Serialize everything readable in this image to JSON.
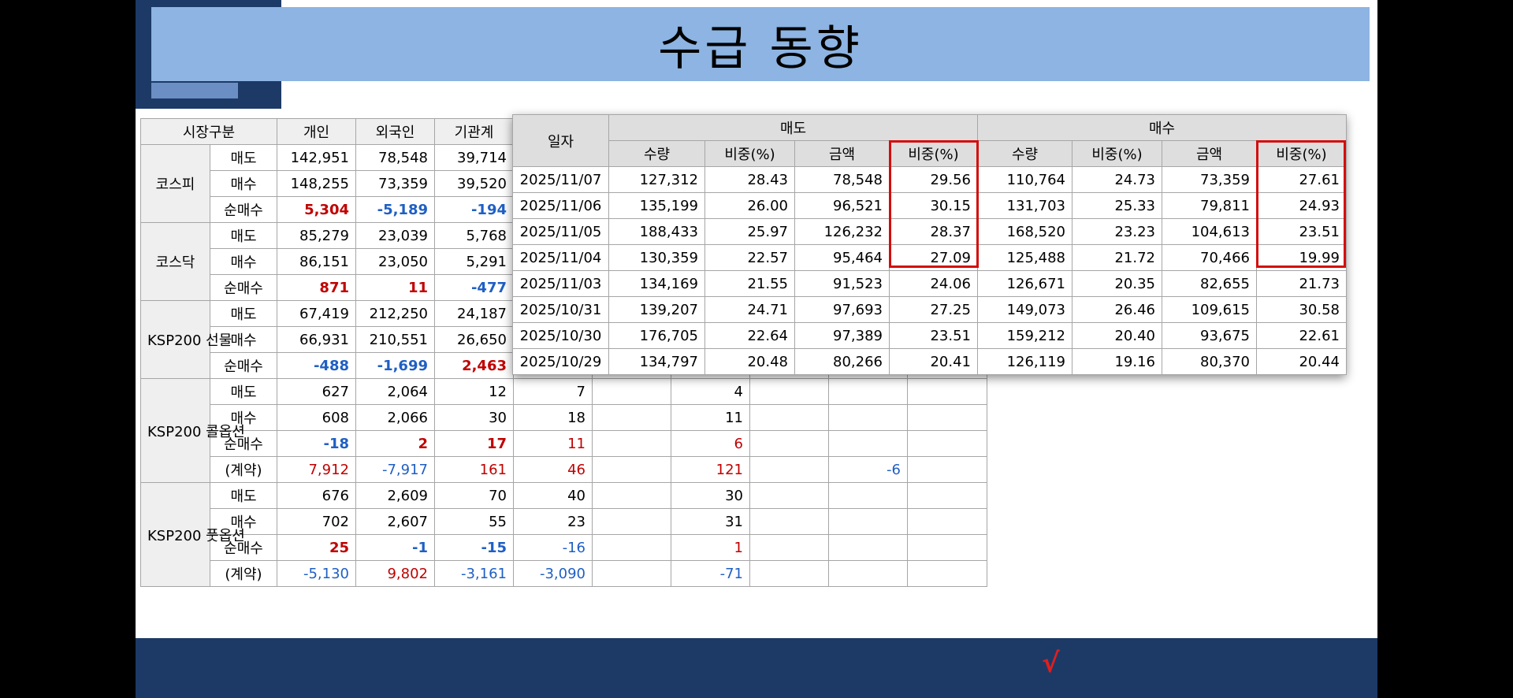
{
  "title": "수급 동향",
  "colors": {
    "accent_navy": "#1d3a66",
    "title_band": "#8db4e2",
    "positive": "#c00000",
    "negative": "#1f5fc4",
    "highlight_box": "#d40d0d"
  },
  "footer": {
    "mark": "√"
  },
  "supply": {
    "headers": [
      "시장구분",
      "개인",
      "외국인",
      "기관계"
    ],
    "markets": [
      {
        "name": "코스피",
        "rows": [
          {
            "label": "매도",
            "values": [
              "142,951",
              "78,548",
              "39,714"
            ]
          },
          {
            "label": "매수",
            "values": [
              "148,255",
              "73,359",
              "39,520"
            ]
          },
          {
            "label": "순매수",
            "values": [
              "5,304",
              "-5,189",
              "-194"
            ]
          }
        ]
      },
      {
        "name": "코스닥",
        "rows": [
          {
            "label": "매도",
            "values": [
              "85,279",
              "23,039",
              "5,768"
            ]
          },
          {
            "label": "매수",
            "values": [
              "86,151",
              "23,050",
              "5,291"
            ]
          },
          {
            "label": "순매수",
            "values": [
              "871",
              "11",
              "-477"
            ]
          }
        ]
      },
      {
        "name": "KSP200 선물",
        "rows": [
          {
            "label": "매도",
            "values": [
              "67,419",
              "212,250",
              "24,187"
            ]
          },
          {
            "label": "매수",
            "values": [
              "66,931",
              "210,551",
              "26,650"
            ]
          },
          {
            "label": "순매수",
            "values": [
              "-488",
              "-1,699",
              "2,463"
            ]
          }
        ]
      },
      {
        "name": "KSP200 콜옵션",
        "rows": [
          {
            "label": "매도",
            "values": [
              "627",
              "2,064",
              "12",
              "7",
              "",
              "4",
              "",
              "",
              ""
            ]
          },
          {
            "label": "매수",
            "values": [
              "608",
              "2,066",
              "30",
              "18",
              "",
              "11",
              "",
              "",
              ""
            ]
          },
          {
            "label": "순매수",
            "values": [
              "-18",
              "2",
              "17",
              "11",
              "",
              "6",
              "",
              "",
              ""
            ]
          },
          {
            "label": "(계약)",
            "values": [
              "7,912",
              "-7,917",
              "161",
              "46",
              "",
              "121",
              "",
              "-6",
              ""
            ]
          }
        ]
      },
      {
        "name": "KSP200 풋옵션",
        "rows": [
          {
            "label": "매도",
            "values": [
              "676",
              "2,609",
              "70",
              "40",
              "",
              "30",
              "",
              "",
              ""
            ]
          },
          {
            "label": "매수",
            "values": [
              "702",
              "2,607",
              "55",
              "23",
              "",
              "31",
              "",
              "",
              ""
            ]
          },
          {
            "label": "순매수",
            "values": [
              "25",
              "-1",
              "-15",
              "-16",
              "",
              "1",
              "",
              "",
              ""
            ]
          },
          {
            "label": "(계약)",
            "values": [
              "-5,130",
              "9,802",
              "-3,161",
              "-3,090",
              "",
              "-71",
              "",
              "",
              ""
            ]
          }
        ]
      }
    ]
  },
  "daily": {
    "date_header": "일자",
    "sell_header": "매도",
    "buy_header": "매수",
    "sub_headers": [
      "수량",
      "비중(%)",
      "금액",
      "비중(%)",
      "수량",
      "비중(%)",
      "금액",
      "비중(%)"
    ],
    "rows": [
      {
        "date": "2025/11/07",
        "cells": [
          "127,312",
          "28.43",
          "78,548",
          "29.56",
          "110,764",
          "24.73",
          "73,359",
          "27.61"
        ]
      },
      {
        "date": "2025/11/06",
        "cells": [
          "135,199",
          "26.00",
          "96,521",
          "30.15",
          "131,703",
          "25.33",
          "79,811",
          "24.93"
        ]
      },
      {
        "date": "2025/11/05",
        "cells": [
          "188,433",
          "25.97",
          "126,232",
          "28.37",
          "168,520",
          "23.23",
          "104,613",
          "23.51"
        ]
      },
      {
        "date": "2025/11/04",
        "cells": [
          "130,359",
          "22.57",
          "95,464",
          "27.09",
          "125,488",
          "21.72",
          "70,466",
          "19.99"
        ]
      },
      {
        "date": "2025/11/03",
        "cells": [
          "134,169",
          "21.55",
          "91,523",
          "24.06",
          "126,671",
          "20.35",
          "82,655",
          "21.73"
        ]
      },
      {
        "date": "2025/10/31",
        "cells": [
          "139,207",
          "24.71",
          "97,693",
          "27.25",
          "149,073",
          "26.46",
          "109,615",
          "30.58"
        ]
      },
      {
        "date": "2025/10/30",
        "cells": [
          "176,705",
          "22.64",
          "97,389",
          "23.51",
          "159,212",
          "20.40",
          "93,675",
          "22.61"
        ]
      },
      {
        "date": "2025/10/29",
        "cells": [
          "134,797",
          "20.48",
          "80,266",
          "20.41",
          "126,119",
          "19.16",
          "80,370",
          "20.44"
        ]
      }
    ]
  }
}
